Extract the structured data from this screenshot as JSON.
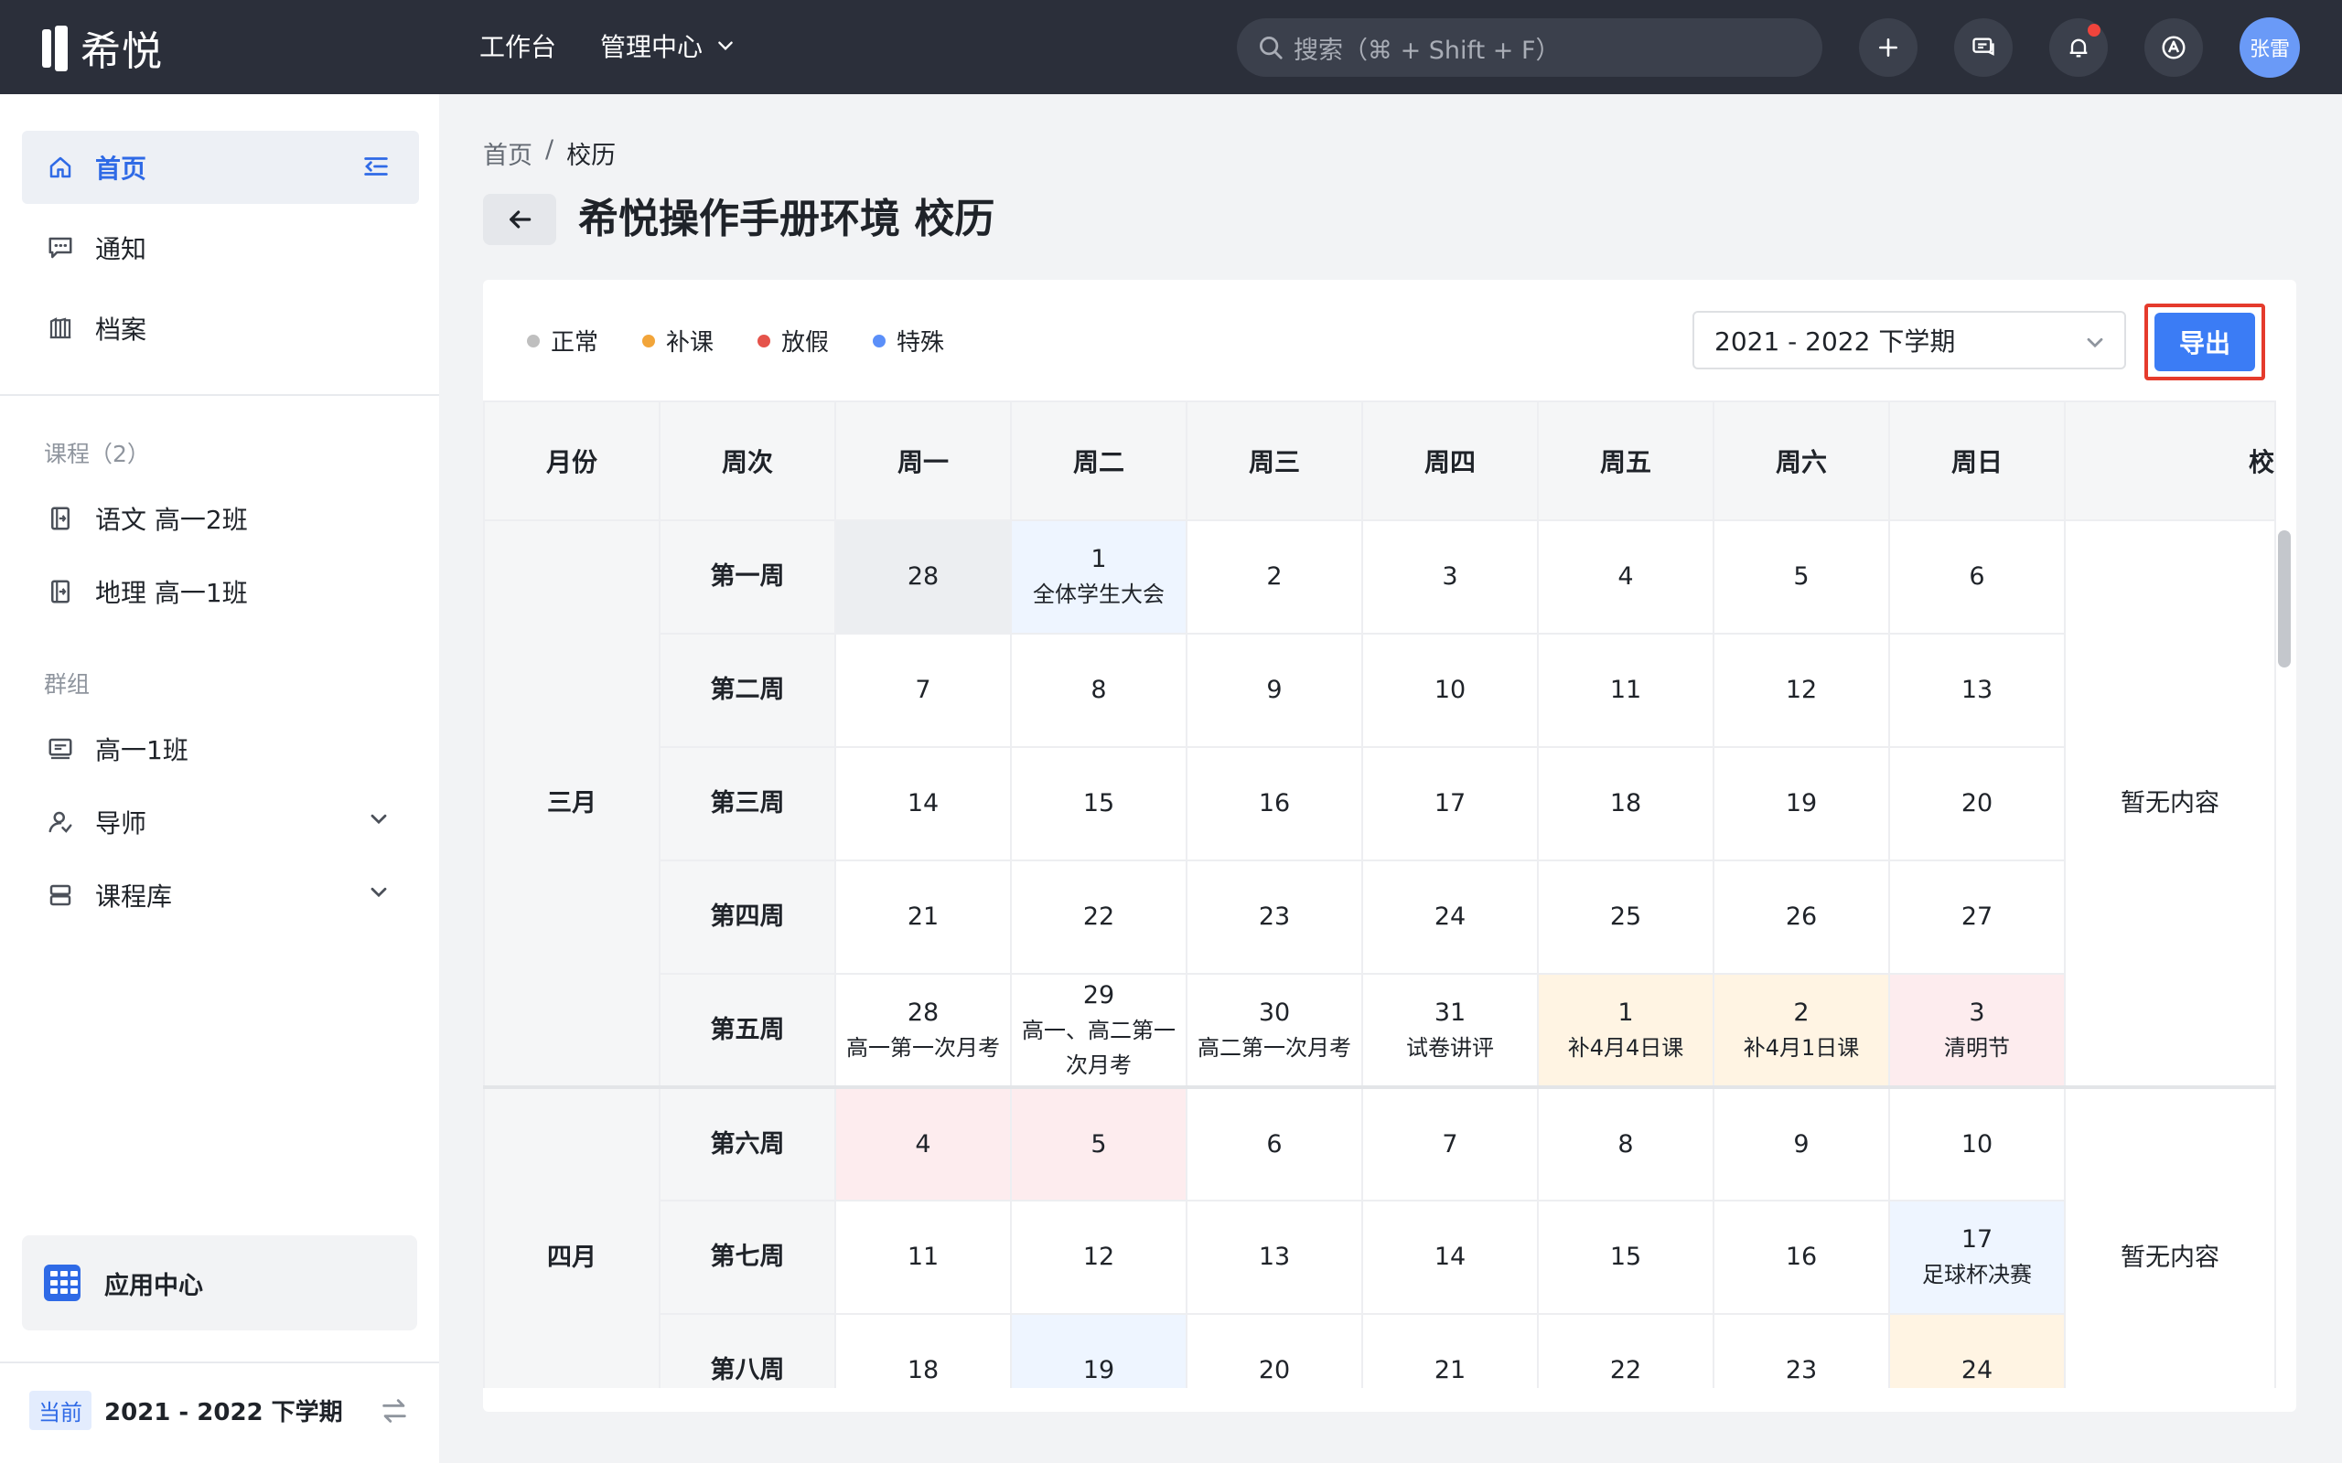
{
  "header": {
    "logo_text": "希悦",
    "nav": [
      {
        "label": "工作台"
      },
      {
        "label": "管理中心"
      }
    ],
    "search_placeholder": "搜索（⌘ + Shift + F）",
    "user": "张雷"
  },
  "sidebar": {
    "items": [
      {
        "label": "首页",
        "icon": "home-icon",
        "active": true
      },
      {
        "label": "通知",
        "icon": "chat-icon"
      },
      {
        "label": "档案",
        "icon": "archive-icon"
      }
    ],
    "courses_title": "课程（2）",
    "courses": [
      {
        "label": "语文 高一2班"
      },
      {
        "label": "地理 高一1班"
      }
    ],
    "groups_title": "群组",
    "groups": [
      {
        "label": "高一1班"
      },
      {
        "label": "导师"
      },
      {
        "label": "课程库"
      }
    ],
    "app_center": "应用中心",
    "term_badge": "当前",
    "term_label": "2021 - 2022 下学期"
  },
  "breadcrumb": [
    "首页",
    "/",
    "校历"
  ],
  "page_title": "希悦操作手册环境 校历",
  "legend": [
    {
      "label": "正常",
      "color": "#bfbfbf"
    },
    {
      "label": "补课",
      "color": "#f2a53a"
    },
    {
      "label": "放假",
      "color": "#e5534b"
    },
    {
      "label": "特殊",
      "color": "#5b8ff9"
    }
  ],
  "term_select": "2021 - 2022 下学期",
  "export_label": "导出",
  "calendar": {
    "headers": [
      "月份",
      "周次",
      "周一",
      "周二",
      "周三",
      "周四",
      "周五",
      "周六",
      "周日",
      "校"
    ],
    "empty_note": "暂无内容",
    "months": [
      {
        "name": "三月",
        "weeks": [
          {
            "label": "第一周",
            "days": [
              {
                "d": "28",
                "t": "muted"
              },
              {
                "d": "1",
                "l": "全体学生大会",
                "t": "special"
              },
              {
                "d": "2"
              },
              {
                "d": "3"
              },
              {
                "d": "4"
              },
              {
                "d": "5"
              },
              {
                "d": "6"
              }
            ]
          },
          {
            "label": "第二周",
            "days": [
              {
                "d": "7"
              },
              {
                "d": "8"
              },
              {
                "d": "9"
              },
              {
                "d": "10"
              },
              {
                "d": "11"
              },
              {
                "d": "12"
              },
              {
                "d": "13"
              }
            ]
          },
          {
            "label": "第三周",
            "days": [
              {
                "d": "14"
              },
              {
                "d": "15"
              },
              {
                "d": "16"
              },
              {
                "d": "17"
              },
              {
                "d": "18"
              },
              {
                "d": "19"
              },
              {
                "d": "20"
              }
            ]
          },
          {
            "label": "第四周",
            "days": [
              {
                "d": "21"
              },
              {
                "d": "22"
              },
              {
                "d": "23"
              },
              {
                "d": "24"
              },
              {
                "d": "25"
              },
              {
                "d": "26"
              },
              {
                "d": "27"
              }
            ]
          },
          {
            "label": "第五周",
            "days": [
              {
                "d": "28",
                "l": "高一第一次月考"
              },
              {
                "d": "29",
                "l": "高一、高二第一次月考"
              },
              {
                "d": "30",
                "l": "高二第一次月考"
              },
              {
                "d": "31",
                "l": "试卷讲评"
              },
              {
                "d": "1",
                "l": "补4月4日课",
                "t": "makeup"
              },
              {
                "d": "2",
                "l": "补4月1日课",
                "t": "makeup"
              },
              {
                "d": "3",
                "l": "清明节",
                "t": "holiday"
              }
            ]
          }
        ]
      },
      {
        "name": "四月",
        "weeks": [
          {
            "label": "第六周",
            "days": [
              {
                "d": "4",
                "t": "holiday"
              },
              {
                "d": "5",
                "t": "holiday"
              },
              {
                "d": "6"
              },
              {
                "d": "7"
              },
              {
                "d": "8"
              },
              {
                "d": "9"
              },
              {
                "d": "10"
              }
            ]
          },
          {
            "label": "第七周",
            "days": [
              {
                "d": "11"
              },
              {
                "d": "12"
              },
              {
                "d": "13"
              },
              {
                "d": "14"
              },
              {
                "d": "15"
              },
              {
                "d": "16"
              },
              {
                "d": "17",
                "l": "足球杯决赛",
                "t": "special"
              }
            ]
          },
          {
            "label": "第八周",
            "days": [
              {
                "d": "18"
              },
              {
                "d": "19",
                "t": "special"
              },
              {
                "d": "20"
              },
              {
                "d": "21"
              },
              {
                "d": "22"
              },
              {
                "d": "23"
              },
              {
                "d": "24",
                "t": "makeup"
              }
            ]
          }
        ]
      }
    ]
  }
}
